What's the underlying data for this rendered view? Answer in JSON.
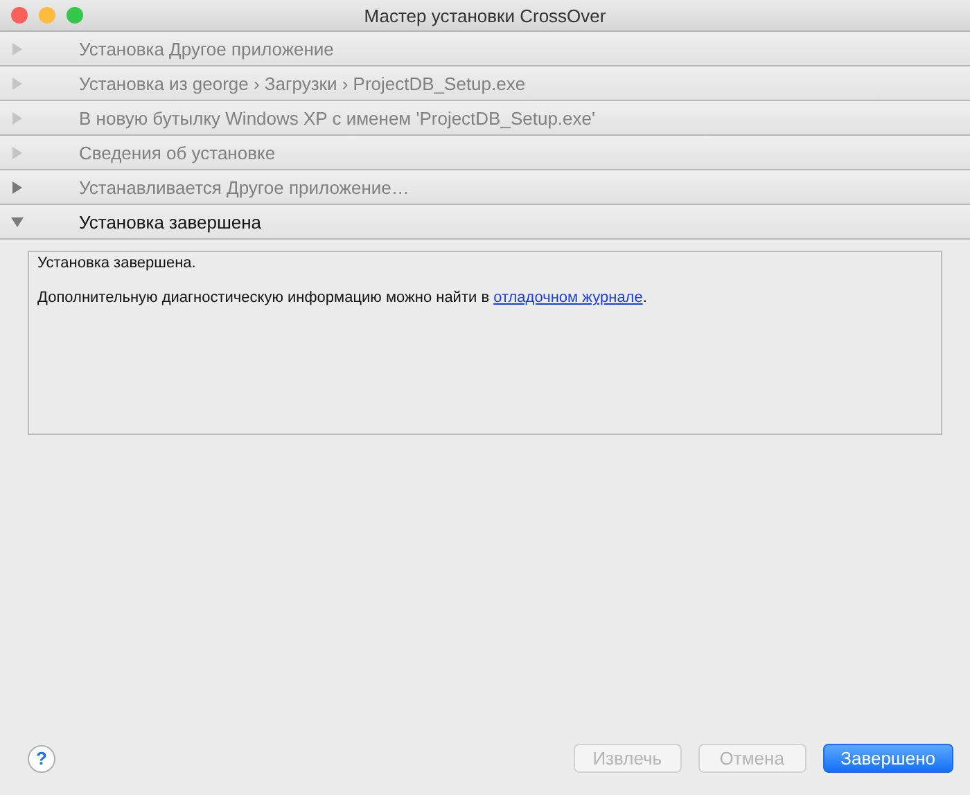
{
  "window": {
    "title": "Мастер установки CrossOver"
  },
  "steps": [
    {
      "label": "Установка Другое приложение",
      "disabled": true,
      "expanded": false
    },
    {
      "label": "Установка из george › Загрузки › ProjectDB_Setup.exe",
      "disabled": true,
      "expanded": false
    },
    {
      "label": "В новую бутылку Windows XP с именем 'ProjectDB_Setup.exe'",
      "disabled": true,
      "expanded": false
    },
    {
      "label": "Сведения об установке",
      "disabled": true,
      "expanded": false
    },
    {
      "label": "Устанавливается Другое приложение…",
      "disabled": false,
      "expanded": false
    },
    {
      "label": "Установка завершена",
      "disabled": false,
      "expanded": true
    }
  ],
  "panel": {
    "heading": "Установка завершена.",
    "message_before": "Дополнительную диагностическую информацию можно найти в ",
    "link": "отладочном журнале",
    "message_after": "."
  },
  "help_button": {
    "label": "?"
  },
  "buttons": [
    {
      "label": "Извлечь",
      "disabled": true,
      "default": false
    },
    {
      "label": "Отмена",
      "disabled": true,
      "default": false
    },
    {
      "label": "Завершено",
      "disabled": false,
      "default": true
    }
  ]
}
